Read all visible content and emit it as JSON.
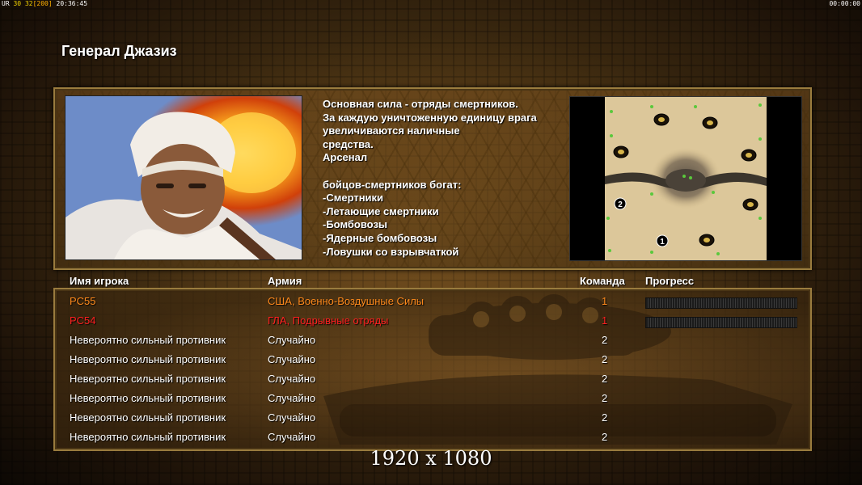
{
  "hud": {
    "left_prefix": "UR",
    "fps": "30",
    "fps_extra": "32",
    "cap": "[200]",
    "clock": "20:36:45",
    "timer": "00:00:00"
  },
  "title": "Генерал Джазиз",
  "description": "Основная сила - отряды смертников.\nЗа каждую уничтоженную единицу врага\n увеличиваются наличные\nсредства.\nАрсенал\n\nбойцов-смертников богат:\n-Смертники\n-Летающие смертники\n-Бомбовозы\n-Ядерные бомбовозы\n-Ловушки со взрывчаткой",
  "minimap": {
    "markers": [
      "2",
      "1"
    ]
  },
  "headers": {
    "name": "Имя игрока",
    "army": "Армия",
    "team": "Команда",
    "progress": "Прогресс"
  },
  "players": [
    {
      "name": "PC55",
      "army": "США, Военно-Воздушные Силы",
      "team": "1",
      "color": "#ff8a1c",
      "progress": 0
    },
    {
      "name": "PC54",
      "army": "ГЛА, Подрывные отряды",
      "team": "1",
      "color": "#ff2020",
      "progress": 0
    },
    {
      "name": "Невероятно сильный противник",
      "army": "Случайно",
      "team": "2",
      "color": "#ffffff"
    },
    {
      "name": "Невероятно сильный противник",
      "army": "Случайно",
      "team": "2",
      "color": "#ffffff"
    },
    {
      "name": "Невероятно сильный противник",
      "army": "Случайно",
      "team": "2",
      "color": "#ffffff"
    },
    {
      "name": "Невероятно сильный противник",
      "army": "Случайно",
      "team": "2",
      "color": "#ffffff"
    },
    {
      "name": "Невероятно сильный противник",
      "army": "Случайно",
      "team": "2",
      "color": "#ffffff"
    },
    {
      "name": "Невероятно сильный противник",
      "army": "Случайно",
      "team": "2",
      "color": "#ffffff"
    }
  ],
  "resolution": "1920 x 1080",
  "colors": {
    "accent": "#9a7c3e",
    "usa": "#ff8a1c",
    "gla": "#ff2020"
  }
}
